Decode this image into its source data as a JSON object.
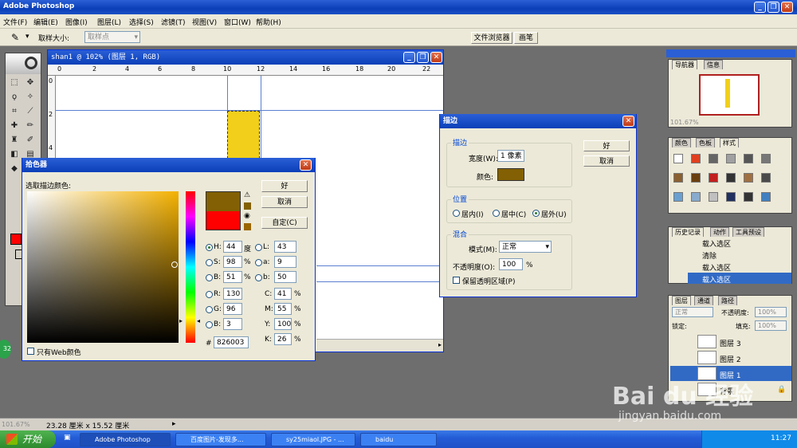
{
  "app": {
    "title": "Adobe Photoshop"
  },
  "menu": [
    "文件(F)",
    "编辑(E)",
    "图像(I)",
    "图层(L)",
    "选择(S)",
    "滤镜(T)",
    "视图(V)",
    "窗口(W)",
    "帮助(H)"
  ],
  "options": {
    "sample_label": "取样大小:",
    "sample_value": "取样点",
    "tabs": [
      "文件浏览器",
      "画笔"
    ]
  },
  "document": {
    "title": "shan1 @ 102% (图层 1, RGB)",
    "ruler_ticks": [
      "0",
      "2",
      "4",
      "6",
      "8",
      "10",
      "12",
      "14",
      "16",
      "18",
      "20",
      "22"
    ],
    "vruler": [
      "0",
      "2",
      "4"
    ]
  },
  "picker": {
    "title": "拾色器",
    "prompt": "选取描边颜色:",
    "ok": "好",
    "cancel": "取消",
    "custom": "自定(C)",
    "web_only": "只有Web颜色",
    "hex_label": "#",
    "hex": "826003",
    "new_color": "#826003",
    "old_color": "#ff0000",
    "hsb": [
      {
        "label": "H:",
        "value": "44",
        "unit": "度"
      },
      {
        "label": "S:",
        "value": "98",
        "unit": "%"
      },
      {
        "label": "B:",
        "value": "51",
        "unit": "%"
      }
    ],
    "rgb": [
      {
        "label": "R:",
        "value": "130"
      },
      {
        "label": "G:",
        "value": "96"
      },
      {
        "label": "B:",
        "value": "3"
      }
    ],
    "lab": [
      {
        "label": "L:",
        "value": "43"
      },
      {
        "label": "a:",
        "value": "9"
      },
      {
        "label": "b:",
        "value": "50"
      }
    ],
    "cmyk": [
      {
        "label": "C:",
        "value": "41",
        "unit": "%"
      },
      {
        "label": "M:",
        "value": "55",
        "unit": "%"
      },
      {
        "label": "Y:",
        "value": "100",
        "unit": "%"
      },
      {
        "label": "K:",
        "value": "26",
        "unit": "%"
      }
    ]
  },
  "stroke": {
    "title": "描边",
    "group_stroke": "描边",
    "width_label": "宽度(W):",
    "width_value": "1 像素",
    "color_label": "颜色:",
    "color": "#826003",
    "ok": "好",
    "cancel": "取消",
    "group_position": "位置",
    "pos_inside": "居内(I)",
    "pos_center": "居中(C)",
    "pos_outside": "居外(U)",
    "group_blend": "混合",
    "mode_label": "模式(M):",
    "mode_value": "正常",
    "opacity_label": "不透明度(O):",
    "opacity_value": "100",
    "opacity_unit": "%",
    "preserve": "保留透明区域(P)"
  },
  "navigator": {
    "tabs": [
      "导航器",
      "信息"
    ],
    "zoom": "101.67%"
  },
  "swatches": {
    "tabs": [
      "颜色",
      "色板",
      "样式"
    ]
  },
  "history": {
    "tabs": [
      "历史记录",
      "动作",
      "工具预设"
    ],
    "items": [
      "载入选区",
      "清除",
      "载入选区",
      "载入选区"
    ]
  },
  "layers": {
    "tabs": [
      "图层",
      "通道",
      "路径"
    ],
    "mode": "正常",
    "opacity_label": "不透明度:",
    "opacity": "100%",
    "lock_label": "锁定:",
    "fill_label": "填充:",
    "fill": "100%",
    "items": [
      "图层 3",
      "图层 2",
      "图层 1",
      "背景"
    ]
  },
  "status": {
    "zoom": "101.67%",
    "size": "23.28 厘米 x 15.52 厘米"
  },
  "taskbar": {
    "start": "开始",
    "tasks": [
      "Adobe Photoshop",
      "百度图片-发现多...",
      "sy25miaol.JPG - ...",
      "baidu"
    ],
    "clock": "11:27"
  },
  "watermark": {
    "brand": "Bai du 经验",
    "url": "jingyan.baidu.com"
  }
}
